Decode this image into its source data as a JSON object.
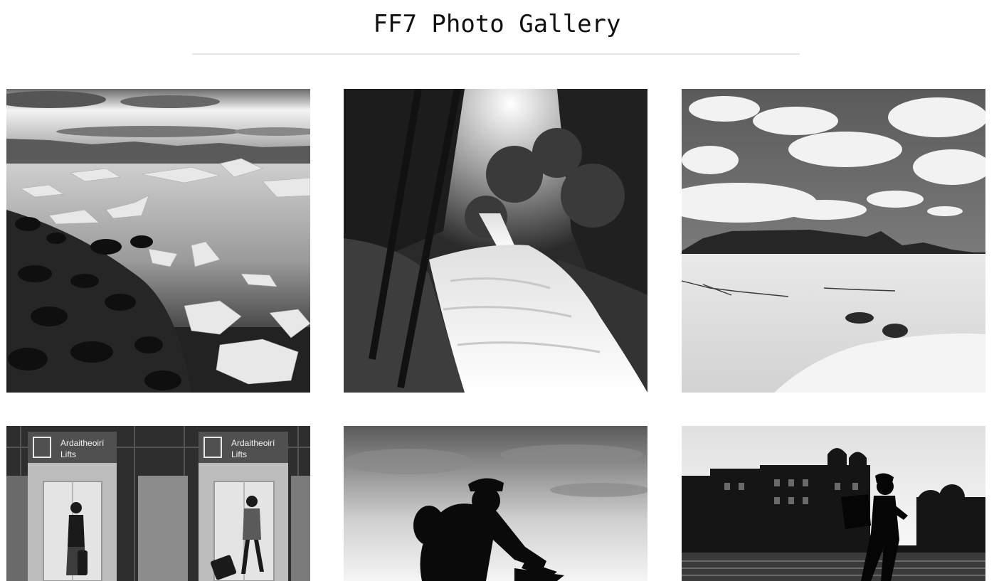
{
  "header": {
    "title": "FF7 Photo Gallery"
  },
  "gallery": {
    "photos": [
      {
        "subject": "glacier-lagoon-ice-icon"
      },
      {
        "subject": "forest-waterfall-icon"
      },
      {
        "subject": "desert-dunes-mountains-icon"
      },
      {
        "subject": "airport-lifts-icon",
        "sign_text": "Ardaitheoirí",
        "sign_subtext": "Lifts"
      },
      {
        "subject": "cyclist-silhouette-icon"
      },
      {
        "subject": "waterfront-building-walker-icon"
      }
    ]
  },
  "colors": {
    "background": "#ffffff",
    "title": "#111111",
    "divider": "#e6e6e6"
  }
}
